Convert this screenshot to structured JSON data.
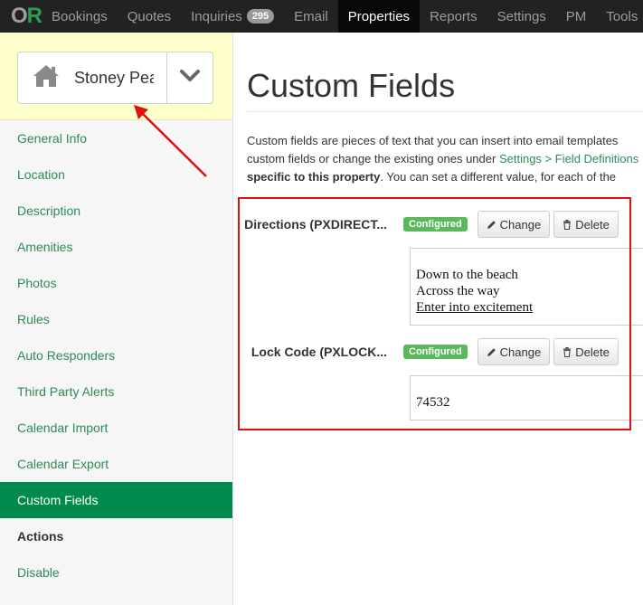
{
  "logo": {
    "o": "O",
    "r": "R"
  },
  "nav": {
    "items": [
      {
        "label": "Bookings"
      },
      {
        "label": "Quotes"
      },
      {
        "label": "Inquiries",
        "badge": "295"
      },
      {
        "label": "Email"
      },
      {
        "label": "Properties",
        "active": true
      },
      {
        "label": "Reports"
      },
      {
        "label": "Settings"
      },
      {
        "label": "PM"
      },
      {
        "label": "Tools"
      }
    ]
  },
  "property_selector": {
    "name": "Stoney Peak",
    "icon": "house-icon"
  },
  "sidebar": {
    "items": [
      {
        "label": "General Info"
      },
      {
        "label": "Location"
      },
      {
        "label": "Description"
      },
      {
        "label": "Amenities"
      },
      {
        "label": "Photos"
      },
      {
        "label": "Rules"
      },
      {
        "label": "Auto Responders"
      },
      {
        "label": "Third Party Alerts"
      },
      {
        "label": "Calendar Import"
      },
      {
        "label": "Calendar Export"
      },
      {
        "label": "Custom Fields"
      },
      {
        "label": "Actions"
      },
      {
        "label": "Disable"
      }
    ]
  },
  "main": {
    "title": "Custom Fields",
    "intro": {
      "line1": "Custom fields are pieces of text that you can insert into email templates",
      "line2_pre": "custom fields or change the existing ones under ",
      "line2_link": "Settings > Field Definitions",
      "line3_bold": "specific to this property",
      "line3_rest": ".  You can set a different value, for each of the"
    },
    "fields": [
      {
        "label": "Directions (PXDIRECT...",
        "status": "Configured",
        "change_label": "Change",
        "delete_label": "Delete",
        "value_lines": [
          "Down to the beach",
          "Across the way",
          "Enter into excitement"
        ]
      },
      {
        "label": "Lock Code (PXLOCK...",
        "status": "Configured",
        "change_label": "Change",
        "delete_label": "Delete",
        "value_lines": [
          "74532"
        ]
      }
    ]
  },
  "colors": {
    "accent": "#008a4c",
    "nav_bg": "#222222",
    "configured": "#5cb85c",
    "annotation": "#dd1111",
    "selector_bg": "#ffffcc"
  }
}
